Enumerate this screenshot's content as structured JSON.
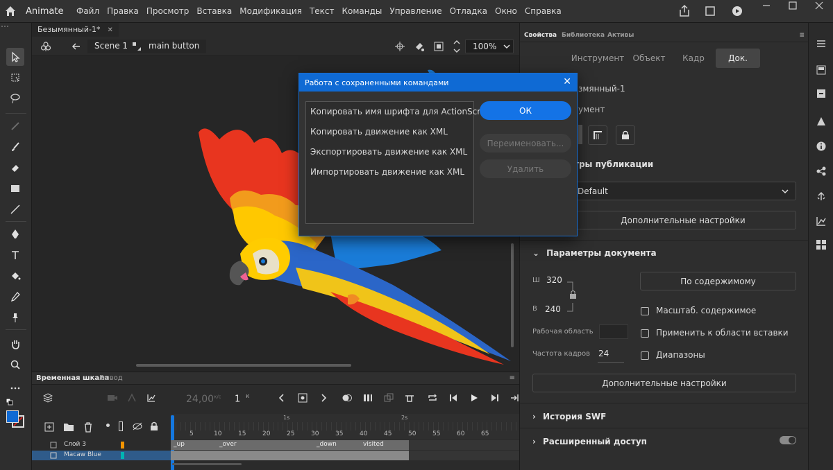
{
  "app": {
    "name": "Animate"
  },
  "menu": [
    "Файл",
    "Правка",
    "Просмотр",
    "Вставка",
    "Модификация",
    "Текст",
    "Команды",
    "Управление",
    "Отладка",
    "Окно",
    "Справка"
  ],
  "document": {
    "tab_title": "Безымянный-1*"
  },
  "editbar": {
    "scene": "Scene 1",
    "symbol": "main button",
    "zoom": "100%"
  },
  "dialog": {
    "title": "Работа с сохраненными командами",
    "items": [
      "Копировать имя шрифта для ActionScript",
      "Копировать движение как XML",
      "Экспортировать движение как XML",
      "Импортировать движение как XML"
    ],
    "ok": "ОК",
    "rename": "Переименовать...",
    "delete": "Удалить"
  },
  "timeline": {
    "tabs": [
      "Временная шкала",
      "Вывод"
    ],
    "fps": "24,00",
    "fps_unit": "к/с",
    "frame": "1",
    "frame_unit": "К",
    "ruler": [
      "5",
      "10",
      "15",
      "20",
      "25",
      "30",
      "35",
      "40",
      "45",
      "50",
      "55",
      "60",
      "65"
    ],
    "seconds": [
      "1s",
      "2s"
    ],
    "layers": [
      {
        "name": "Слой 3",
        "color": "#f29400"
      },
      {
        "name": "Macaw Blue",
        "color": "#00b3b3"
      }
    ],
    "labels": [
      "_up",
      "_over",
      "_down",
      "visited"
    ]
  },
  "props": {
    "tabs": [
      "Свойства",
      "Библиотека",
      "Активы"
    ],
    "seg": [
      "Инструмент",
      "Объект",
      "Кадр",
      "Док."
    ],
    "doc_name": "змянный-1",
    "doc_label": "умент",
    "publish_title": "тры публикации",
    "profile": "Default",
    "adv1": "Дополнительные настройки",
    "docparams": "Параметры документа",
    "w_label": "Ш",
    "w": "320",
    "h_label": "В",
    "h": "240",
    "fit": "По содержимому",
    "stage_label": "Рабочая область",
    "fps_label": "Частота кадров",
    "fps": "24",
    "scale": "Масштаб. содержимое",
    "apply_paste": "Применить к области вставки",
    "ranges": "Диапазоны",
    "adv2": "Дополнительные настройки",
    "swf": "История SWF",
    "access": "Расширенный доступ"
  }
}
